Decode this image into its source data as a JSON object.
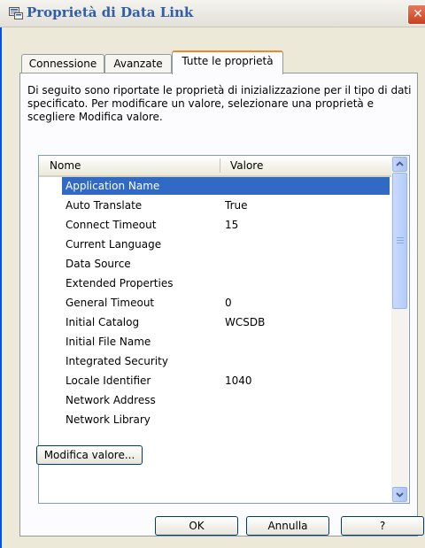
{
  "window": {
    "title": "Proprietà di Data Link",
    "close_glyph": "✕",
    "icon": "datalink-window-icon"
  },
  "tabs": [
    {
      "label": "Connessione",
      "active": false
    },
    {
      "label": "Avanzate",
      "active": false
    },
    {
      "label": "Tutte le proprietà",
      "active": true
    }
  ],
  "description": "Di seguito sono riportate le proprietà di inizializzazione per il tipo di dati specificato. Per modificare un valore, selezionare una proprietà e scegliere Modifica valore.",
  "grid": {
    "col_name": "Nome",
    "col_value": "Valore",
    "rows": [
      {
        "name": "Application Name",
        "value": ""
      },
      {
        "name": "Auto Translate",
        "value": "True"
      },
      {
        "name": "Connect Timeout",
        "value": "15"
      },
      {
        "name": "Current Language",
        "value": ""
      },
      {
        "name": "Data Source",
        "value": ""
      },
      {
        "name": "Extended Properties",
        "value": ""
      },
      {
        "name": "General Timeout",
        "value": "0"
      },
      {
        "name": "Initial Catalog",
        "value": "WCSDB"
      },
      {
        "name": "Initial File Name",
        "value": ""
      },
      {
        "name": "Integrated Security",
        "value": ""
      },
      {
        "name": "Locale Identifier",
        "value": "1040"
      },
      {
        "name": "Network Address",
        "value": ""
      },
      {
        "name": "Network Library",
        "value": ""
      }
    ],
    "selected_row": "Application Name"
  },
  "buttons": {
    "edit": "Modifica valore...",
    "ok": "OK",
    "cancel": "Annulla",
    "help": "?"
  },
  "colors": {
    "selection": "#316ac5",
    "active_tab_accent": "#e68b2c",
    "title_text": "#2f5fa8"
  }
}
